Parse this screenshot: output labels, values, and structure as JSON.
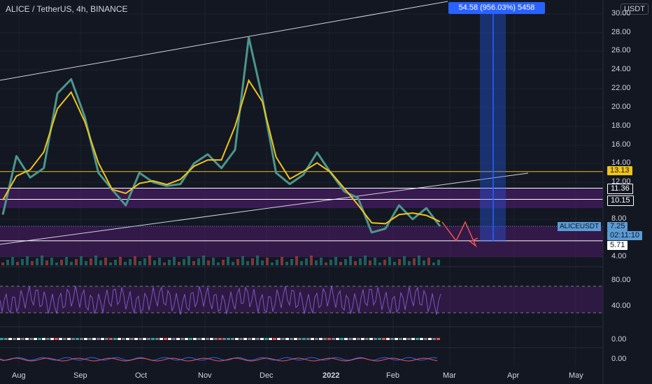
{
  "header": {
    "title": "ALICE / TetherUS, 4h, BINANCE",
    "currency_button": "USDT"
  },
  "measure_label": "54.58 (956.03%) 5458",
  "price_labels": {
    "l13": "13.13",
    "l1136": "11.36",
    "l1015": "10.15",
    "symbol": "ALICEUSDT",
    "current": "7.25",
    "countdown": "02:11:10",
    "l571": "5.71"
  },
  "colors": {
    "bg": "#131722",
    "yellow": "#f0c419",
    "purple": "#7b1fa2",
    "green": "#26a69a",
    "red": "#ef5350",
    "rsi": "#7e57c2",
    "blue": "#2962ff"
  },
  "chart_data": {
    "type": "candlestick",
    "title": "ALICE / TetherUS, 4h, BINANCE",
    "x_ticks": [
      "Aug",
      "Sep",
      "Oct",
      "Nov",
      "Dec",
      "2022",
      "Feb",
      "Mar",
      "Apr",
      "May"
    ],
    "y_ticks": [
      "30.00",
      "28.00",
      "26.00",
      "24.00",
      "22.00",
      "20.00",
      "18.00",
      "16.00",
      "14.00",
      "12.00",
      "8.00",
      "4.00"
    ],
    "ylim": [
      3.5,
      30
    ],
    "price_path": [
      {
        "t": "Aug",
        "v": 8.5
      },
      {
        "t": "Aug",
        "v": 14.8
      },
      {
        "t": "Aug",
        "v": 12.5
      },
      {
        "t": "Aug",
        "v": 13.5
      },
      {
        "t": "Sep",
        "v": 21.5
      },
      {
        "t": "Sep",
        "v": 23.0
      },
      {
        "t": "Sep",
        "v": 19.0
      },
      {
        "t": "Sep",
        "v": 13.0
      },
      {
        "t": "Sep",
        "v": 11.2
      },
      {
        "t": "Oct",
        "v": 9.5
      },
      {
        "t": "Oct",
        "v": 13.0
      },
      {
        "t": "Oct",
        "v": 12.0
      },
      {
        "t": "Oct",
        "v": 11.6
      },
      {
        "t": "Oct",
        "v": 11.8
      },
      {
        "t": "Nov",
        "v": 14.0
      },
      {
        "t": "Nov",
        "v": 15.0
      },
      {
        "t": "Nov",
        "v": 13.5
      },
      {
        "t": "Nov",
        "v": 15.5
      },
      {
        "t": "Nov",
        "v": 27.5
      },
      {
        "t": "Dec",
        "v": 21.0
      },
      {
        "t": "Dec",
        "v": 13.0
      },
      {
        "t": "Dec",
        "v": 11.8
      },
      {
        "t": "Dec",
        "v": 12.8
      },
      {
        "t": "2022",
        "v": 15.2
      },
      {
        "t": "2022",
        "v": 13.0
      },
      {
        "t": "2022",
        "v": 11.0
      },
      {
        "t": "2022",
        "v": 10.3
      },
      {
        "t": "2022",
        "v": 6.6
      },
      {
        "t": "Feb",
        "v": 7.0
      },
      {
        "t": "Feb",
        "v": 9.5
      },
      {
        "t": "Feb",
        "v": 8.0
      },
      {
        "t": "Feb",
        "v": 9.2
      },
      {
        "t": "Feb",
        "v": 7.25
      }
    ],
    "horizontal_levels": [
      13.13,
      11.36,
      10.15,
      5.71
    ],
    "current_price": 7.25,
    "rsi": {
      "levels": [
        70,
        30
      ],
      "ticks": [
        "80.00",
        "40.00"
      ]
    },
    "indicator_ticks": [
      "0.00",
      "0.00"
    ]
  }
}
